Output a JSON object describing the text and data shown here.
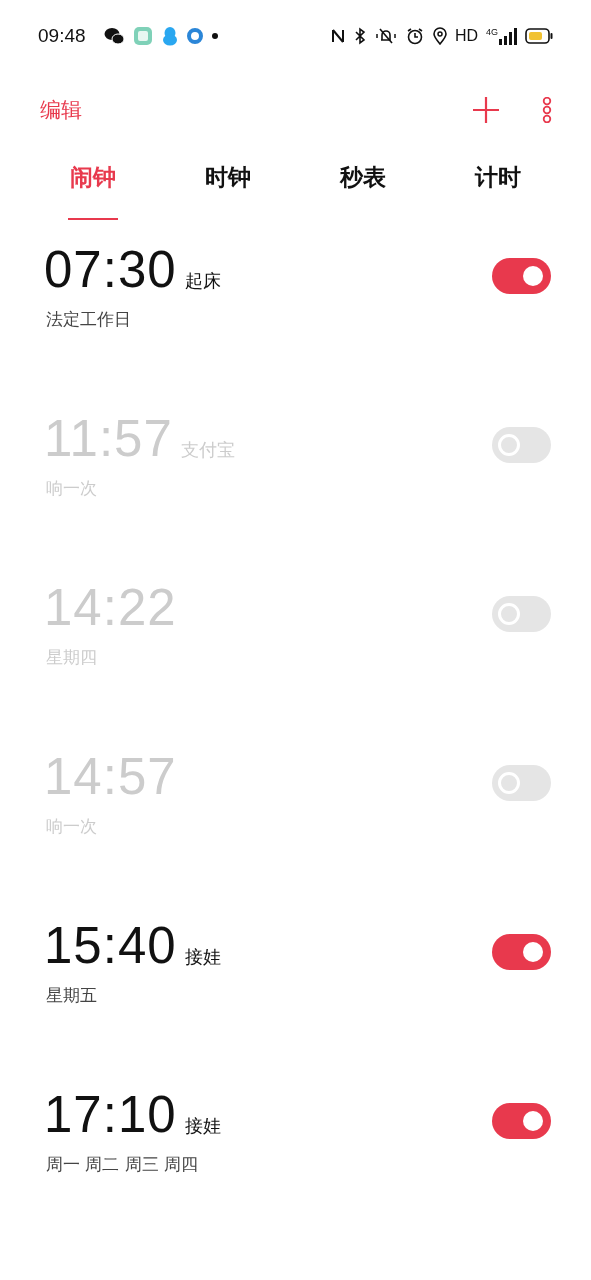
{
  "status_bar": {
    "time": "09:48",
    "network": "HD",
    "cellular": "4G"
  },
  "header": {
    "edit": "编辑"
  },
  "tabs": [
    {
      "label": "闹钟",
      "selected": true
    },
    {
      "label": "时钟",
      "selected": false
    },
    {
      "label": "秒表",
      "selected": false
    },
    {
      "label": "计时",
      "selected": false
    }
  ],
  "alarms": [
    {
      "time": "07:30",
      "label": "起床",
      "repeat": "法定工作日",
      "on": true
    },
    {
      "time": "11:57",
      "label": "支付宝",
      "repeat": "响一次",
      "on": false
    },
    {
      "time": "14:22",
      "repeat": "星期四",
      "on": false
    },
    {
      "time": "14:57",
      "repeat": "响一次",
      "on": false
    },
    {
      "time": "15:40",
      "label": "接娃",
      "repeat": "星期五",
      "on": true
    },
    {
      "time": "17:10",
      "label": "接娃",
      "repeat": "周一 周二 周三 周四",
      "on": true
    }
  ]
}
